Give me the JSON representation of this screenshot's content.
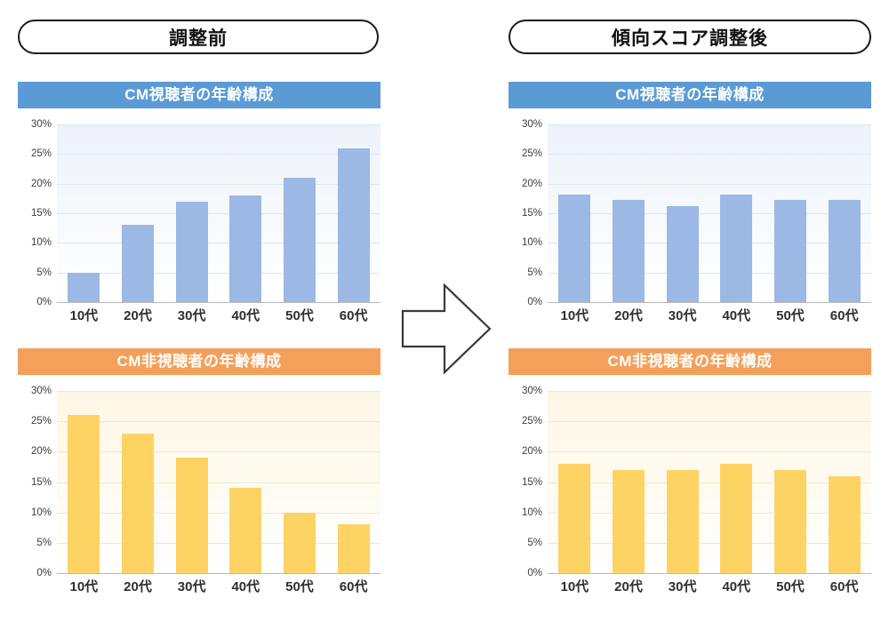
{
  "headers": {
    "before": "調整前",
    "after": "傾向スコア調整後"
  },
  "colors": {
    "viewer_header": "#5B9BD5",
    "viewer_bar": "#9CB8E4",
    "nonviewer_header": "#F4A05A",
    "nonviewer_bar": "#FDD364",
    "arrow_outline": "#3a3a3a"
  },
  "icons": {
    "arrow": "right-block-arrow-icon"
  },
  "axis": {
    "y_ticks": [
      "30%",
      "25%",
      "20%",
      "15%",
      "10%",
      "5%",
      "0%"
    ],
    "y_min": 0,
    "y_max": 30,
    "x_categories": [
      "10代",
      "20代",
      "30代",
      "40代",
      "50代",
      "60代"
    ]
  },
  "charts": [
    {
      "id": "before-viewer",
      "title": "CM視聴者の年齢構成",
      "theme": "blue",
      "values": [
        5,
        13,
        17,
        18,
        21,
        26
      ]
    },
    {
      "id": "after-viewer",
      "title": "CM視聴者の年齢構成",
      "theme": "blue",
      "values": [
        18.2,
        17.2,
        16.2,
        18.2,
        17.2,
        17.2
      ]
    },
    {
      "id": "before-nonviewer",
      "title": "CM非視聴者の年齢構成",
      "theme": "orange",
      "values": [
        26,
        23,
        19,
        14,
        10,
        8
      ]
    },
    {
      "id": "after-nonviewer",
      "title": "CM非視聴者の年齢構成",
      "theme": "orange",
      "values": [
        18,
        17,
        17,
        18,
        17,
        16
      ]
    }
  ],
  "chart_data": [
    {
      "type": "bar",
      "title": "CM視聴者の年齢構成 (調整前)",
      "categories": [
        "10代",
        "20代",
        "30代",
        "40代",
        "50代",
        "60代"
      ],
      "values": [
        5,
        13,
        17,
        18,
        21,
        26
      ],
      "xlabel": "",
      "ylabel": "",
      "ylim": [
        0,
        30
      ],
      "ytick_labels": [
        "0%",
        "5%",
        "10%",
        "15%",
        "20%",
        "25%",
        "30%"
      ],
      "grid": true,
      "legend": "none",
      "color": "#9CB8E4"
    },
    {
      "type": "bar",
      "title": "CM非視聴者の年齢構成 (調整前)",
      "categories": [
        "10代",
        "20代",
        "30代",
        "40代",
        "50代",
        "60代"
      ],
      "values": [
        26,
        23,
        19,
        14,
        10,
        8
      ],
      "xlabel": "",
      "ylabel": "",
      "ylim": [
        0,
        30
      ],
      "ytick_labels": [
        "0%",
        "5%",
        "10%",
        "15%",
        "20%",
        "25%",
        "30%"
      ],
      "grid": true,
      "legend": "none",
      "color": "#FDD364"
    },
    {
      "type": "bar",
      "title": "CM視聴者の年齢構成 (傾向スコア調整後)",
      "categories": [
        "10代",
        "20代",
        "30代",
        "40代",
        "50代",
        "60代"
      ],
      "values": [
        18.2,
        17.2,
        16.2,
        18.2,
        17.2,
        17.2
      ],
      "xlabel": "",
      "ylabel": "",
      "ylim": [
        0,
        30
      ],
      "ytick_labels": [
        "0%",
        "5%",
        "10%",
        "15%",
        "20%",
        "25%",
        "30%"
      ],
      "grid": true,
      "legend": "none",
      "color": "#9CB8E4"
    },
    {
      "type": "bar",
      "title": "CM非視聴者の年齢構成 (傾向スコア調整後)",
      "categories": [
        "10代",
        "20代",
        "30代",
        "40代",
        "50代",
        "60代"
      ],
      "values": [
        18,
        17,
        17,
        18,
        17,
        16
      ],
      "xlabel": "",
      "ylabel": "",
      "ylim": [
        0,
        30
      ],
      "ytick_labels": [
        "0%",
        "5%",
        "10%",
        "15%",
        "20%",
        "25%",
        "30%"
      ],
      "grid": true,
      "legend": "none",
      "color": "#FDD364"
    }
  ]
}
